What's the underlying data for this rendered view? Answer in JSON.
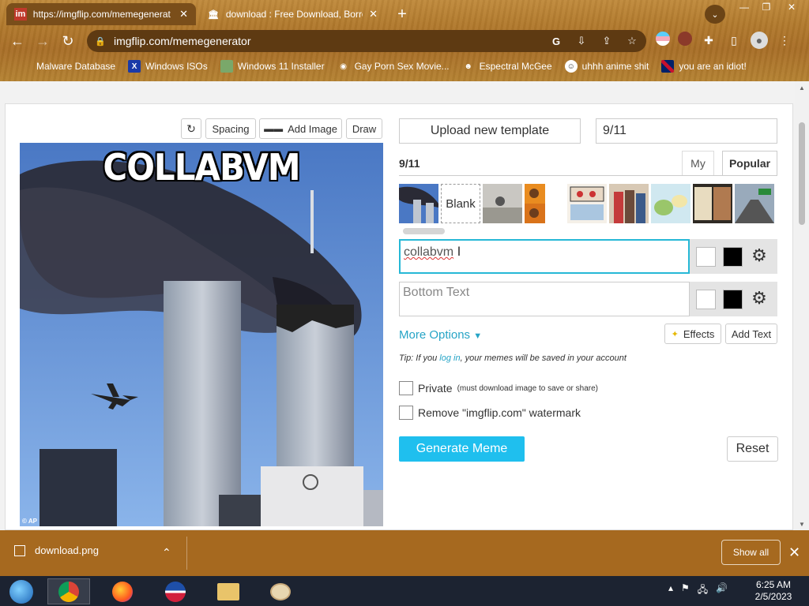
{
  "browser": {
    "tabs": [
      {
        "title": "https://imgflip.com/memegenerat",
        "active": true
      },
      {
        "title": "download : Free Download, Borrow",
        "active": false
      }
    ],
    "url": "imgflip.com/memegenerator",
    "bookmarks": [
      {
        "label": "Malware Database"
      },
      {
        "label": "Windows ISOs"
      },
      {
        "label": "Windows 11 Installer"
      },
      {
        "label": "Gay Porn Sex Movie..."
      },
      {
        "label": "Espectral McGee"
      },
      {
        "label": "uhhh anime shit"
      },
      {
        "label": "you are an idiot!"
      }
    ]
  },
  "editor": {
    "toolbar": {
      "spacing": "Spacing",
      "add_image": "Add Image",
      "draw": "Draw"
    },
    "meme_caption": "COLLABVM",
    "image_credit": "© AP"
  },
  "panel": {
    "upload_template": "Upload new template",
    "search_value": "9/11",
    "template_name": "9/11",
    "tab_my": "My",
    "tab_popular": "Popular",
    "blank_label": "Blank",
    "top_text_value": "collabvm",
    "bottom_text_placeholder": "Bottom Text",
    "more_options": "More Options",
    "effects": "Effects",
    "add_text": "Add Text",
    "tip_prefix": "Tip: If you ",
    "tip_link": "log in",
    "tip_suffix": ", your memes will be saved in your account",
    "private_label": "Private",
    "private_note": "(must download image to save or share)",
    "watermark_label": "Remove \"imgflip.com\" watermark",
    "generate": "Generate Meme",
    "reset": "Reset"
  },
  "download_bar": {
    "file": "download.png",
    "show_all": "Show all"
  },
  "taskbar": {
    "time": "6:25 AM",
    "date": "2/5/2023"
  },
  "colors": {
    "accent": "#1fbfee",
    "link": "#26a4c6",
    "theme_brown": "#a6691f"
  }
}
